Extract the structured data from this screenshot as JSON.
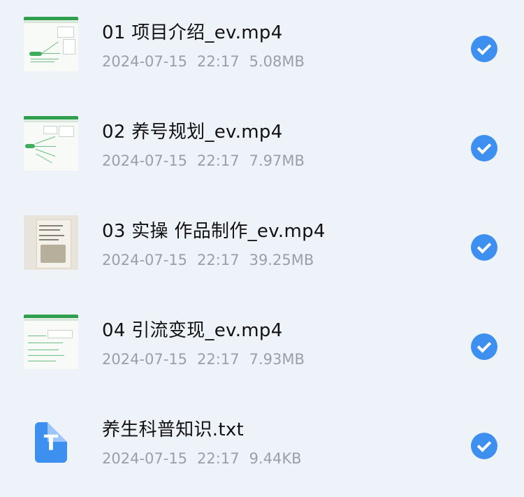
{
  "colors": {
    "background": "#eef3f9",
    "check_accent": "#3d8ff0",
    "meta_text": "#9aa0a8"
  },
  "files": [
    {
      "name": "01 项目介绍_ev.mp4",
      "date": "2024-07-15",
      "time": "22:17",
      "size": "5.08MB",
      "thumbnail": "mindmap-thumbnail",
      "selected": true
    },
    {
      "name": "02 养号规划_ev.mp4",
      "date": "2024-07-15",
      "time": "22:17",
      "size": "7.97MB",
      "thumbnail": "mindmap-thumbnail",
      "selected": true
    },
    {
      "name": "03 实操 作品制作_ev.mp4",
      "date": "2024-07-15",
      "time": "22:17",
      "size": "39.25MB",
      "thumbnail": "photo-thumbnail",
      "selected": true
    },
    {
      "name": "04 引流变现_ev.mp4",
      "date": "2024-07-15",
      "time": "22:17",
      "size": "7.93MB",
      "thumbnail": "mindmap-thumbnail",
      "selected": true
    },
    {
      "name": "养生科普知识.txt",
      "date": "2024-07-15",
      "time": "22:17",
      "size": "9.44KB",
      "thumbnail": "text-file-icon",
      "icon_letter": "T",
      "selected": true
    }
  ]
}
